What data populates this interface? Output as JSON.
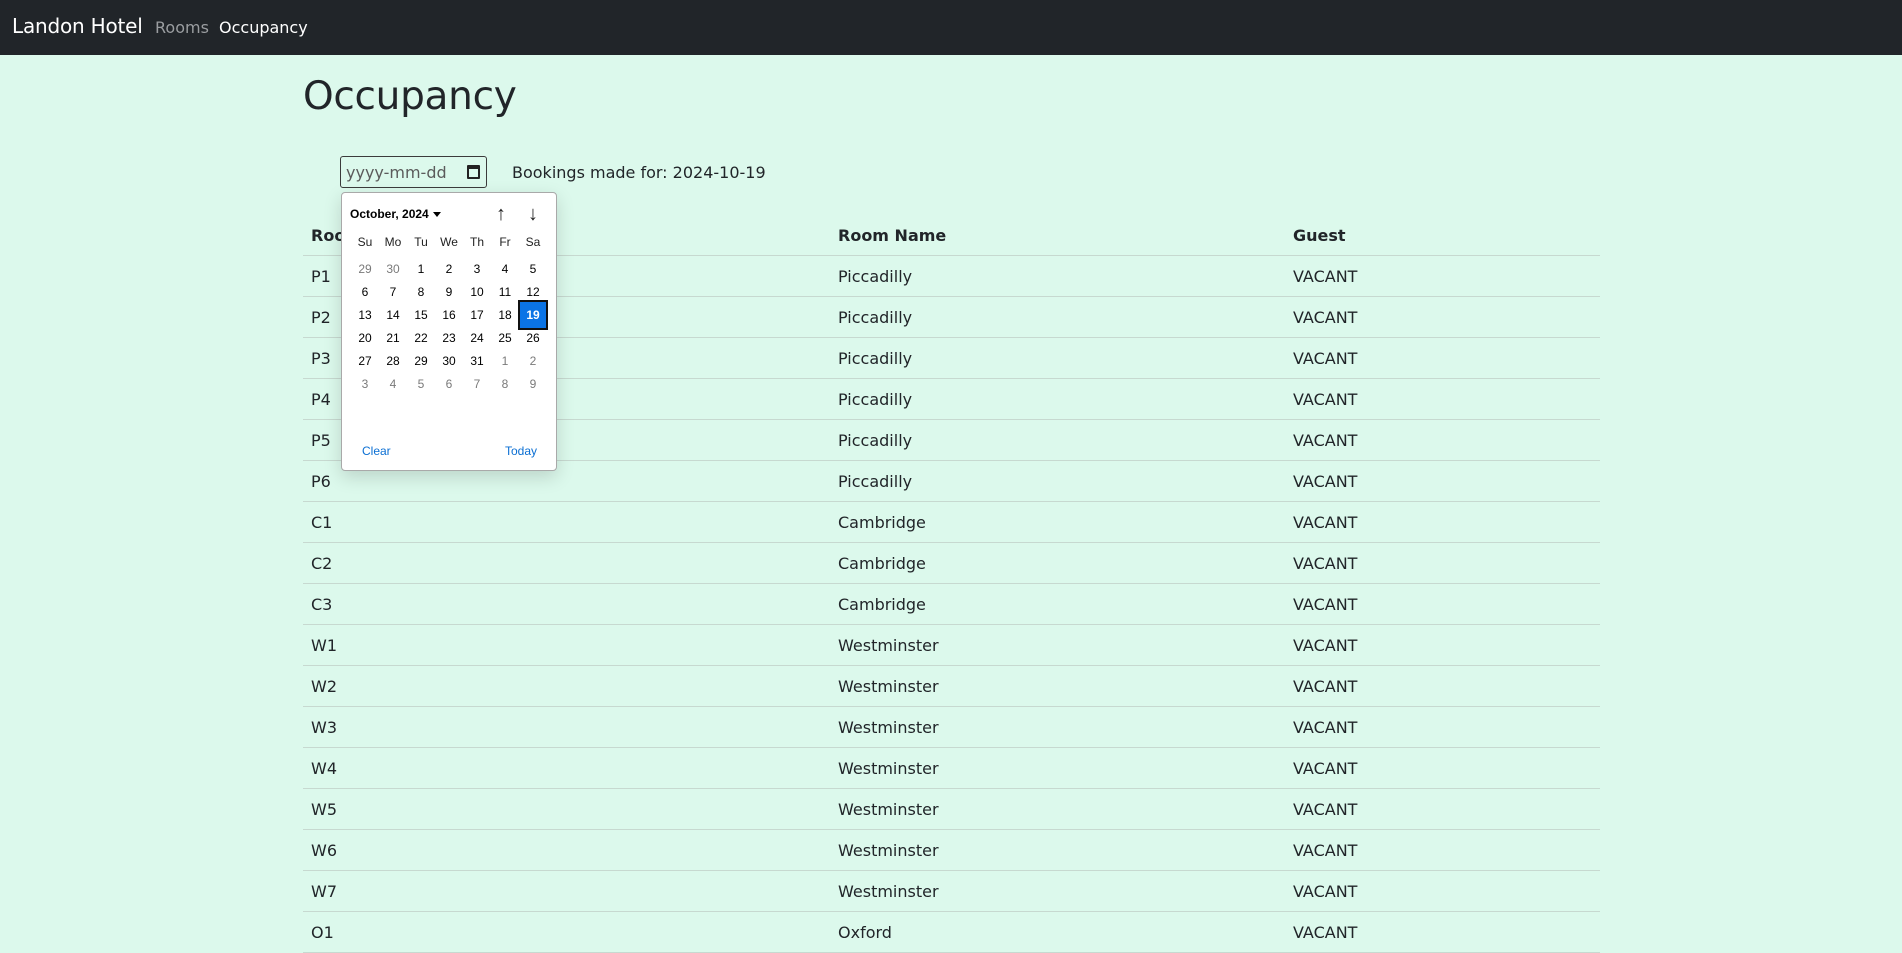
{
  "navbar": {
    "brand": "Landon Hotel",
    "links": [
      "Rooms",
      "Occupancy"
    ]
  },
  "page": {
    "title": "Occupancy",
    "date_input_placeholder": "yyyy-mm-dd",
    "bookings_label": "Bookings made for: 2024-10-19"
  },
  "table": {
    "headers": [
      "Room Number",
      "Room Name",
      "Guest"
    ],
    "rows": [
      [
        "P1",
        "Piccadilly",
        "VACANT"
      ],
      [
        "P2",
        "Piccadilly",
        "VACANT"
      ],
      [
        "P3",
        "Piccadilly",
        "VACANT"
      ],
      [
        "P4",
        "Piccadilly",
        "VACANT"
      ],
      [
        "P5",
        "Piccadilly",
        "VACANT"
      ],
      [
        "P6",
        "Piccadilly",
        "VACANT"
      ],
      [
        "C1",
        "Cambridge",
        "VACANT"
      ],
      [
        "C2",
        "Cambridge",
        "VACANT"
      ],
      [
        "C3",
        "Cambridge",
        "VACANT"
      ],
      [
        "W1",
        "Westminster",
        "VACANT"
      ],
      [
        "W2",
        "Westminster",
        "VACANT"
      ],
      [
        "W3",
        "Westminster",
        "VACANT"
      ],
      [
        "W4",
        "Westminster",
        "VACANT"
      ],
      [
        "W5",
        "Westminster",
        "VACANT"
      ],
      [
        "W6",
        "Westminster",
        "VACANT"
      ],
      [
        "W7",
        "Westminster",
        "VACANT"
      ],
      [
        "O1",
        "Oxford",
        "VACANT"
      ]
    ]
  },
  "datepicker": {
    "month_label": "October, 2024",
    "weekdays": [
      "Su",
      "Mo",
      "Tu",
      "We",
      "Th",
      "Fr",
      "Sa"
    ],
    "weeks": [
      [
        "29",
        "30",
        "1",
        "2",
        "3",
        "4",
        "5"
      ],
      [
        "6",
        "7",
        "8",
        "9",
        "10",
        "11",
        "12"
      ],
      [
        "13",
        "14",
        "15",
        "16",
        "17",
        "18",
        "19"
      ],
      [
        "20",
        "21",
        "22",
        "23",
        "24",
        "25",
        "26"
      ],
      [
        "27",
        "28",
        "29",
        "30",
        "31",
        "1",
        "2"
      ],
      [
        "3",
        "4",
        "5",
        "6",
        "7",
        "8",
        "9"
      ]
    ],
    "muted_days": [
      [
        0,
        0
      ],
      [
        0,
        1
      ],
      [
        4,
        5
      ],
      [
        4,
        6
      ],
      [
        5,
        0
      ],
      [
        5,
        1
      ],
      [
        5,
        2
      ],
      [
        5,
        3
      ],
      [
        5,
        4
      ],
      [
        5,
        5
      ],
      [
        5,
        6
      ]
    ],
    "selected_day": [
      2,
      6
    ],
    "clear_label": "Clear",
    "today_label": "Today",
    "prev_icon": "arrow-up-icon",
    "next_icon": "arrow-down-icon",
    "accent_color": "#0b74e6"
  }
}
